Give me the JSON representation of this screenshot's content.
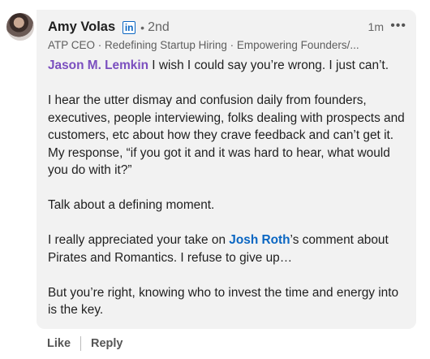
{
  "author": {
    "name": "Amy Volas",
    "degree": "2nd",
    "separator": "•",
    "headline": "ATP CEO · Redefining Startup Hiring · Empowering Founders/...",
    "time": "1m",
    "icon": "linkedin-icon",
    "more": "•••"
  },
  "comment": {
    "p1_mention": "Jason M. Lemkin",
    "p1_text": " I wish I could say you’re wrong. I just can’t.",
    "p2": "I hear the utter dismay and confusion daily from founders, executives, people interviewing, folks dealing with prospects and customers, etc about how they crave feedback and can’t get it. My response, “if you got it and it was hard to hear, what would you do with it?”",
    "p3": "Talk about a defining moment.",
    "p4_before": "I really appreciated your take on ",
    "p4_mention": "Josh Roth",
    "p4_after": "’s comment about Pirates and Romantics. I refuse to give up…",
    "p5": "But you’re right, knowing who to invest the time and energy into is the key."
  },
  "actions": {
    "like": "Like",
    "reply": "Reply"
  },
  "colors": {
    "mention_primary": "#7b4fbf",
    "mention": "#0a66c2",
    "bubble": "#f2f2f2"
  }
}
